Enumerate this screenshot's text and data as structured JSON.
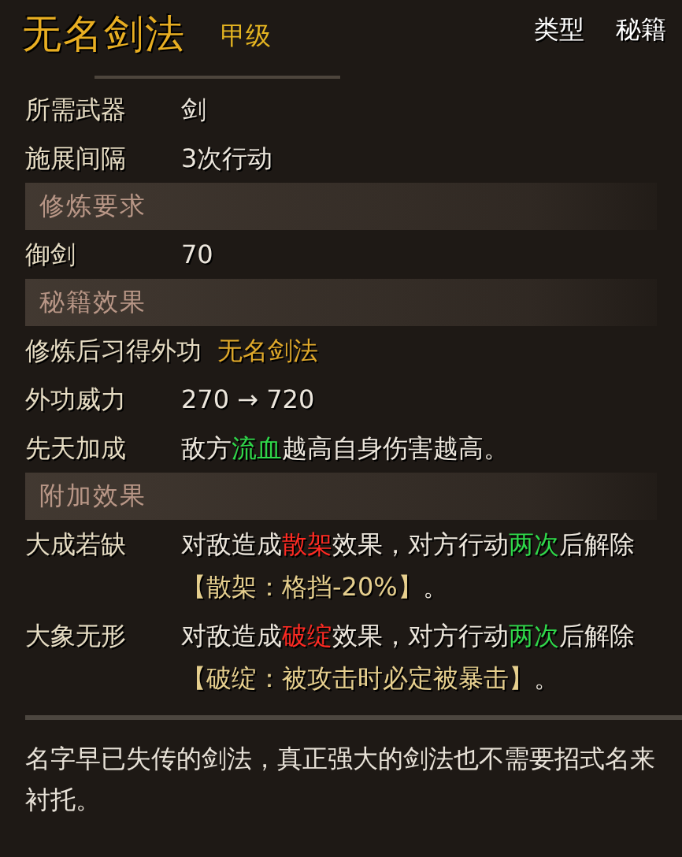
{
  "header": {
    "title": "无名剑法",
    "grade": "甲级",
    "type_label": "类型",
    "type_value": "秘籍"
  },
  "sections": [
    {
      "kind": "rows",
      "rows": [
        {
          "label": "所需武器",
          "value": [
            [
              {
                "t": "剑",
                "color": "#ece6dc"
              }
            ]
          ]
        },
        {
          "label": "施展间隔",
          "value": [
            [
              {
                "t": "3次行动",
                "color": "#ece6dc"
              }
            ]
          ]
        }
      ]
    },
    {
      "kind": "band",
      "title": "修炼要求"
    },
    {
      "kind": "rows",
      "rows": [
        {
          "label": "御剑",
          "value": [
            [
              {
                "t": "70",
                "color": "#ece6dc"
              }
            ]
          ]
        }
      ]
    },
    {
      "kind": "band",
      "title": "秘籍效果"
    },
    {
      "kind": "rows",
      "rows": [
        {
          "label": "修炼后习得外功",
          "value": [
            [
              {
                "t": "无名剑法",
                "color": "#e0a92a"
              }
            ]
          ]
        },
        {
          "label": "外功威力",
          "value": [
            [
              {
                "t": "270 → 720",
                "color": "#ece6dc"
              }
            ]
          ]
        },
        {
          "label": "先天加成",
          "value": [
            [
              {
                "t": "敌方",
                "color": "#ece6dc"
              },
              {
                "t": "流血",
                "color": "#2fd84a"
              },
              {
                "t": "越高自身伤害越高。",
                "color": "#ece6dc"
              }
            ]
          ]
        }
      ]
    },
    {
      "kind": "band",
      "title": "附加效果"
    },
    {
      "kind": "rows",
      "rows": [
        {
          "label": "大成若缺",
          "value": [
            [
              {
                "t": "对敌造成",
                "color": "#ece6dc"
              },
              {
                "t": "散架",
                "color": "#ff2a22"
              },
              {
                "t": "效果，对方行动",
                "color": "#ece6dc"
              },
              {
                "t": "两次",
                "color": "#2fd84a"
              },
              {
                "t": "后解除",
                "color": "#ece6dc"
              }
            ],
            [
              {
                "t": "【散架：格挡-20%】",
                "color": "#e6cf8e"
              },
              {
                "t": "。",
                "color": "#ece6dc"
              }
            ]
          ]
        },
        {
          "label": "大象无形",
          "value": [
            [
              {
                "t": "对敌造成",
                "color": "#ece6dc"
              },
              {
                "t": "破绽",
                "color": "#ff2a22"
              },
              {
                "t": "效果，对方行动",
                "color": "#ece6dc"
              },
              {
                "t": "两次",
                "color": "#2fd84a"
              },
              {
                "t": "后解除",
                "color": "#ece6dc"
              }
            ],
            [
              {
                "t": "【破绽：被攻击时必定被暴击】",
                "color": "#e6cf8e"
              },
              {
                "t": "。",
                "color": "#ece6dc"
              }
            ]
          ]
        }
      ]
    }
  ],
  "description": "名字早已失传的剑法，真正强大的剑法也不需要招式名来衬托。"
}
